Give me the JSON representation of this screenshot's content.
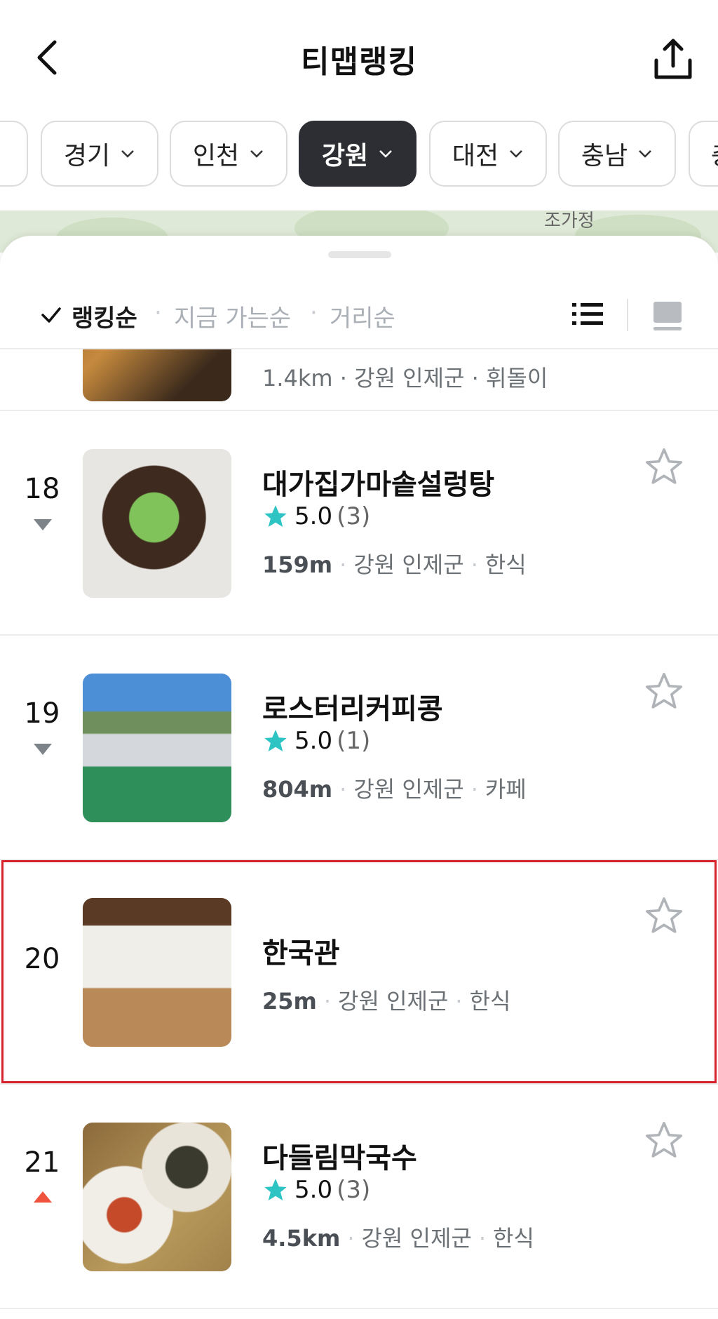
{
  "header": {
    "title": "티맵랭킹"
  },
  "regions": [
    {
      "label": "",
      "active": false
    },
    {
      "label": "경기",
      "active": false
    },
    {
      "label": "인천",
      "active": false
    },
    {
      "label": "강원",
      "active": true
    },
    {
      "label": "대전",
      "active": false
    },
    {
      "label": "충남",
      "active": false
    },
    {
      "label": "충",
      "active": false
    }
  ],
  "map": {
    "label": "조가정"
  },
  "sort": {
    "options": [
      "랭킹순",
      "지금 가는순",
      "거리순"
    ],
    "selected": "랭킹순"
  },
  "partial_row": {
    "meta": "1.4km · 강원 인제군 · 휘돌이"
  },
  "rows": [
    {
      "rank": "18",
      "trend": "down",
      "name": "대가집가마솥설렁탕",
      "rating": "5.0",
      "reviews": "(3)",
      "distance": "159m",
      "region": "강원 인제군",
      "category": "한식",
      "highlighted": false
    },
    {
      "rank": "19",
      "trend": "down",
      "name": "로스터리커피콩",
      "rating": "5.0",
      "reviews": "(1)",
      "distance": "804m",
      "region": "강원 인제군",
      "category": "카페",
      "highlighted": false
    },
    {
      "rank": "20",
      "trend": "",
      "name": "한국관",
      "rating": "",
      "reviews": "",
      "distance": "25m",
      "region": "강원 인제군",
      "category": "한식",
      "highlighted": true
    },
    {
      "rank": "21",
      "trend": "up",
      "name": "다들림막국수",
      "rating": "5.0",
      "reviews": "(3)",
      "distance": "4.5km",
      "region": "강원 인제군",
      "category": "한식",
      "highlighted": false
    }
  ],
  "colors": {
    "active_chip": "#2c2e33",
    "star": "#2ec4c4",
    "trend_down": "#7d8489",
    "trend_up": "#f0533d",
    "highlight": "#d6202a"
  }
}
